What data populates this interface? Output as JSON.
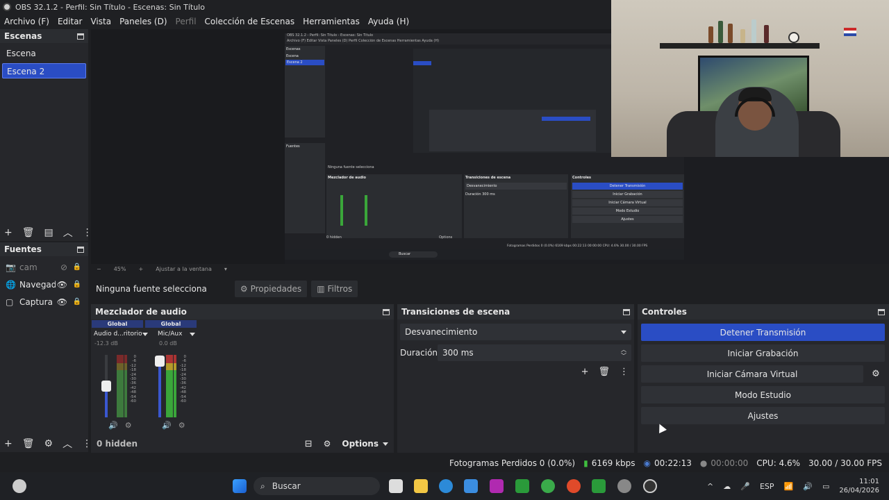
{
  "window": {
    "title": "OBS 32.1.2 - Perfil: Sin Título - Escenas: Sin Título"
  },
  "menu": {
    "items": [
      "Archivo (F)",
      "Editar",
      "Vista",
      "Paneles (D)",
      "Perfil",
      "Colección de Escenas",
      "Herramientas",
      "Ayuda (H)"
    ]
  },
  "scenes": {
    "title": "Escenas",
    "items": [
      "Escena",
      "Escena 2"
    ],
    "selected": "Escena 2"
  },
  "sources": {
    "title": "Fuentes",
    "items": [
      {
        "name": "cam",
        "icon": "camera-icon"
      },
      {
        "name": "Navegadc",
        "icon": "globe-icon"
      },
      {
        "name": "Captura d",
        "icon": "window-icon"
      }
    ]
  },
  "preview": {
    "zoom": "45%",
    "fit_label": "Ajustar a la ventana",
    "mini": {
      "title": "OBS 32.1.2 - Perfil: Sin Título - Escenas: Sin Título",
      "menu": "Archivo (F)   Editar   Vista   Paneles (D)   Perfil   Colección de Escenas   Herramientas   Ayuda (H)",
      "scenes_title": "Escenas",
      "scene1": "Escena",
      "scene2": "Escena 2",
      "sources_title": "Fuentes",
      "no_source": "Ninguna fuente selecciona",
      "mixer_title": "Mezclador de audio",
      "transitions_title": "Transiciones de escena",
      "controls_title": "Controles",
      "stop_stream": "Detener Transmisión",
      "start_rec": "Iniciar Grabación",
      "start_vcam": "Iniciar Cámara Virtual",
      "studio": "Modo Estudio",
      "settings": "Ajustes",
      "fade": "Desvanecimiento",
      "duration": "Duración",
      "duration_value": "300 ms",
      "hidden": "0 hidden",
      "options": "Options",
      "status": "Fotogramas Perdidos 0 (0.0%)   6169 kbps   00:22:13   00:00:00   CPU: 4.6%   30.00 / 30.00 FPS",
      "search": "Buscar"
    }
  },
  "context": {
    "no_source": "Ninguna fuente selecciona",
    "properties": "Propiedades",
    "filters": "Filtros"
  },
  "mixer": {
    "title": "Mezclador de audio",
    "channels": [
      {
        "tag": "Global",
        "name": "Audio d...ritorio",
        "db": "-12.3 dB",
        "level": 0.5
      },
      {
        "tag": "Global",
        "name": "Mic/Aux",
        "db": "0.0 dB",
        "level": 0.9
      }
    ],
    "ticks": [
      "0",
      "-6",
      "-12",
      "-18",
      "-24",
      "-30",
      "-36",
      "-42",
      "-48",
      "-54",
      "-60"
    ],
    "hidden": "0 hidden",
    "options": "Options"
  },
  "transitions": {
    "title": "Transiciones de escena",
    "selected": "Desvanecimiento",
    "duration_label": "Duración",
    "duration_value": "300 ms"
  },
  "controls": {
    "title": "Controles",
    "stop_stream": "Detener Transmisión",
    "start_recording": "Iniciar Grabación",
    "start_virtual_cam": "Iniciar Cámara Virtual",
    "studio_mode": "Modo Estudio",
    "settings": "Ajustes"
  },
  "status": {
    "dropped": "Fotogramas Perdidos 0 (0.0%)",
    "bitrate": "6169 kbps",
    "stream_time": "00:22:13",
    "rec_time": "00:00:00",
    "cpu": "CPU: 4.6%",
    "fps": "30.00 / 30.00 FPS"
  },
  "taskbar": {
    "search": "Buscar",
    "lang": "ESP",
    "time": "11:01",
    "date": "26/04/2026"
  },
  "colors": {
    "accent": "#2a4dc4",
    "background": "#1e1f22",
    "panel": "#26272b"
  }
}
